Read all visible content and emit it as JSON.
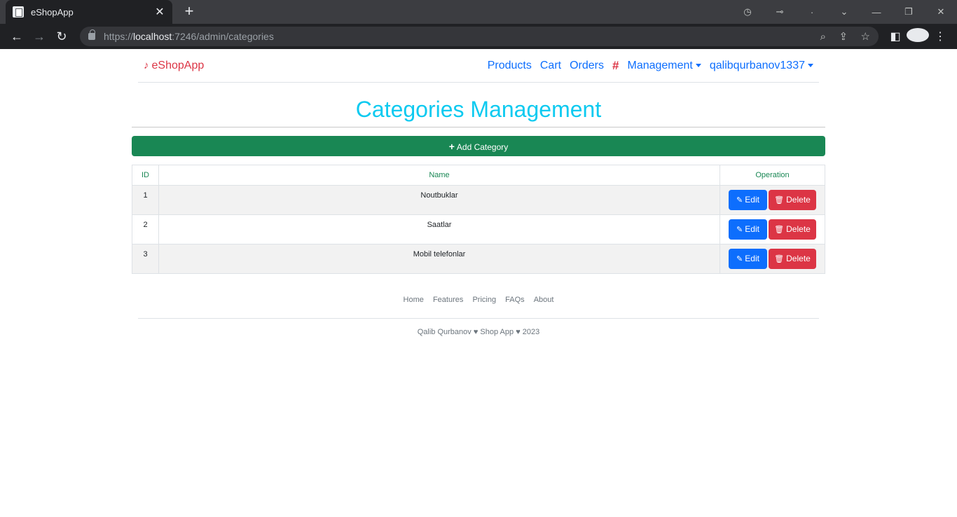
{
  "browser": {
    "tab_title": "eShopApp",
    "url_scheme": "https://",
    "url_host": "localhost",
    "url_path": ":7246/admin/categories"
  },
  "navbar": {
    "brand": "eShopApp",
    "links": [
      "Products",
      "Cart",
      "Orders"
    ],
    "hash": "#",
    "management": "Management",
    "user": "qalibqurbanov1337"
  },
  "main": {
    "title": "Categories Management",
    "add_button": "Add Category",
    "table": {
      "headers": [
        "ID",
        "Name",
        "Operation"
      ],
      "rows": [
        {
          "id": "1",
          "name": "Noutbuklar"
        },
        {
          "id": "2",
          "name": "Saatlar"
        },
        {
          "id": "3",
          "name": "Mobil telefonlar"
        }
      ],
      "edit_label": "Edit",
      "delete_label": "Delete"
    }
  },
  "footer": {
    "links": [
      "Home",
      "Features",
      "Pricing",
      "FAQs",
      "About"
    ],
    "copyright": "Qalib Qurbanov ♥ Shop App ♥ 2023"
  },
  "colors": {
    "accent": "#0d6efd",
    "success": "#198754",
    "danger": "#dc3545",
    "title": "#0dcaf0"
  }
}
